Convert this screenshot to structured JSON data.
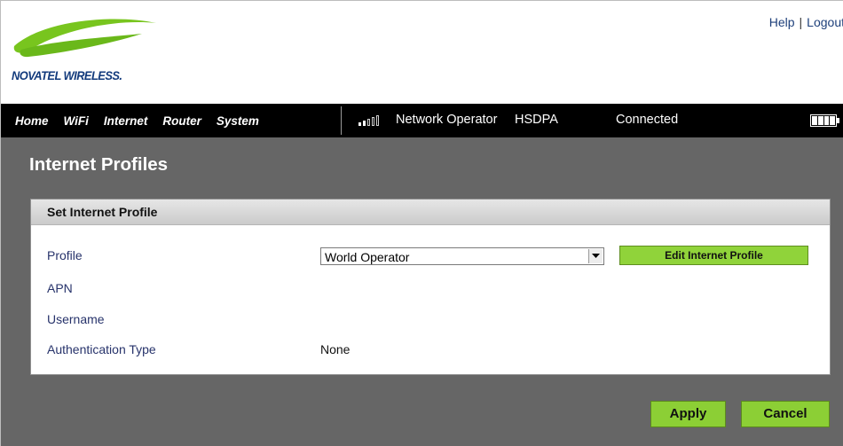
{
  "brand": {
    "logo_text": "NOVATEL WIRELESS.",
    "swoosh_color": "#78c51e"
  },
  "top_links": {
    "help": "Help",
    "separator": "|",
    "logout": "Logout"
  },
  "nav": {
    "items": [
      "Home",
      "WiFi",
      "Internet",
      "Router",
      "System"
    ]
  },
  "status": {
    "signal_bars_on": 2,
    "signal_bars_total": 5,
    "operator": "Network Operator",
    "network_type": "HSDPA",
    "connection": "Connected",
    "battery_icon": "battery-full-icon"
  },
  "page": {
    "title": "Internet Profiles"
  },
  "panel": {
    "title": "Set Internet Profile",
    "profile_label": "Profile",
    "profile_selected": "World Operator",
    "edit_button": "Edit Internet Profile",
    "apn_label": "APN",
    "apn_value": "",
    "username_label": "Username",
    "username_value": "",
    "auth_label": "Authentication Type",
    "auth_value": "None"
  },
  "actions": {
    "apply": "Apply",
    "cancel": "Cancel"
  },
  "colors": {
    "nav_background": "#000000",
    "content_background": "#666666",
    "button_green": "#8ccf35",
    "label_blue": "#27336b"
  }
}
